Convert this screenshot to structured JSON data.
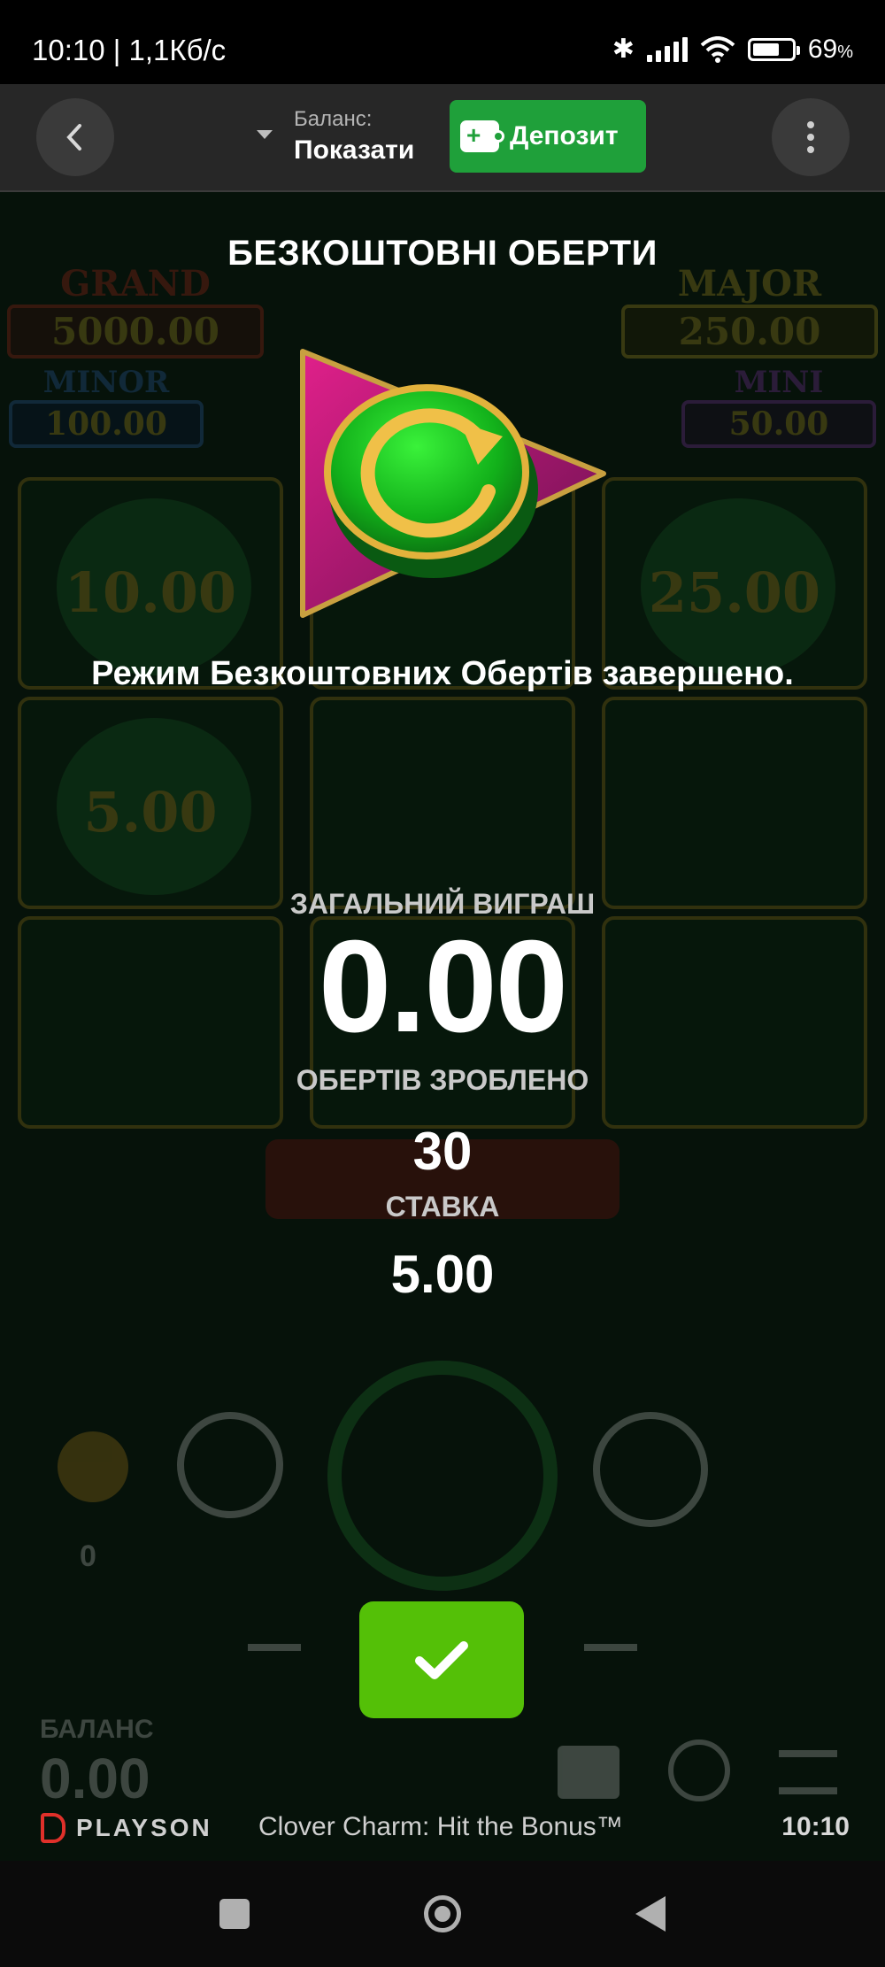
{
  "status_bar": {
    "time_speed": "10:10 | 1,1Кб/с",
    "battery_percent": "69",
    "battery_suffix": "%",
    "battery_level": 0.69
  },
  "header": {
    "balance_label": "Баланс:",
    "balance_value": "Показати",
    "deposit_label": "Депозит"
  },
  "background_game": {
    "jackpots": [
      {
        "name": "GRAND",
        "value": "5000.00"
      },
      {
        "name": "MAJOR",
        "value": "250.00"
      },
      {
        "name": "MINOR",
        "value": "100.00"
      },
      {
        "name": "MINI",
        "value": "50.00"
      }
    ],
    "cells": [
      "10.00",
      "25.00",
      "5.00"
    ],
    "stake_counter": "0",
    "balance_label": "БАЛАНС",
    "balance_value": "0.00"
  },
  "popup": {
    "title": "БЕЗКОШТОВНІ ОБЕРТИ",
    "message": "Режим Безкоштовних Обертів завершено.",
    "total_win_label": "ЗАГАЛЬНИЙ ВИГРАШ",
    "total_win_value": "0.00",
    "spins_label": "ОБЕРТІВ ЗРОБЛЕНО",
    "spins_value": "30",
    "bet_label": "СТАВКА",
    "bet_value": "5.00"
  },
  "footer": {
    "provider": "PLAYSON",
    "game_title": "Clover Charm: Hit the Bonus™",
    "clock": "10:10"
  },
  "colors": {
    "confirm": "#54c007",
    "deposit": "#1fa03a",
    "header_bg": "#272727"
  }
}
